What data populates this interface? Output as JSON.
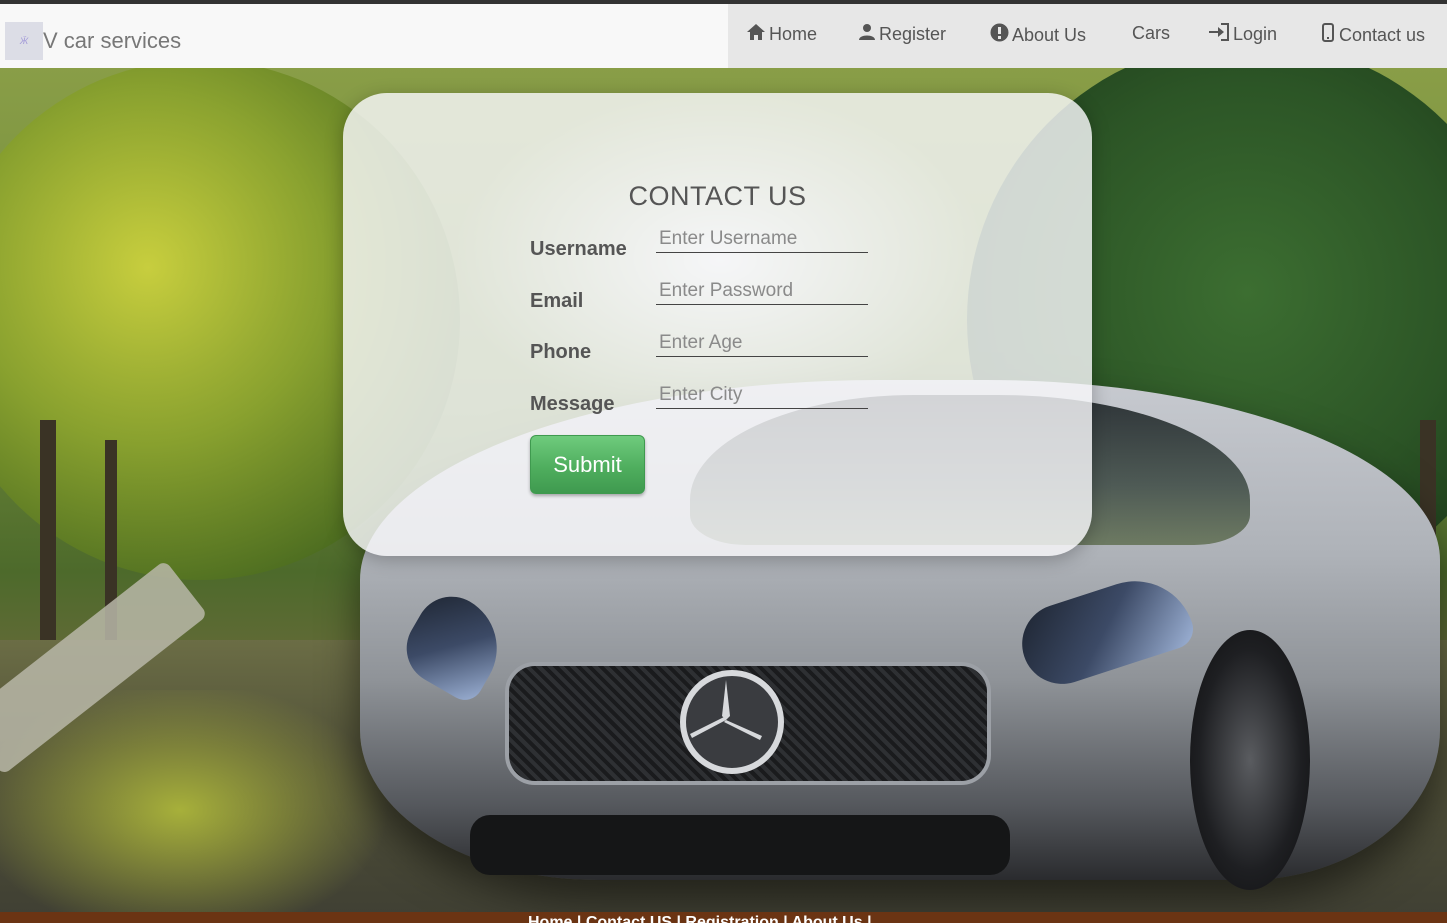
{
  "brand": {
    "logo_text": "Ӝ",
    "name": "V car services"
  },
  "nav": {
    "items": [
      {
        "label": "Home",
        "icon": "home-icon"
      },
      {
        "label": "Register",
        "icon": "user-icon"
      },
      {
        "label": "About Us",
        "icon": "info-icon"
      },
      {
        "label": "Cars",
        "icon": ""
      },
      {
        "label": "Login",
        "icon": "login-icon"
      },
      {
        "label": "Contact us",
        "icon": "phone-icon"
      }
    ]
  },
  "contact": {
    "title": "CONTACT US",
    "fields": [
      {
        "label": "Username",
        "placeholder": "Enter Username",
        "value": ""
      },
      {
        "label": "Email",
        "placeholder": "Enter Password",
        "value": ""
      },
      {
        "label": "Phone",
        "placeholder": "Enter Age",
        "value": ""
      },
      {
        "label": "Message",
        "placeholder": "Enter City",
        "value": ""
      }
    ],
    "submit_label": "Submit"
  },
  "footer": {
    "links_text": "Home | Contact US | Registration | About Us |"
  },
  "colors": {
    "submit_green": "#4fae5e",
    "footer_brown": "#6b3413",
    "nav_bg": "#f8f8f8"
  }
}
